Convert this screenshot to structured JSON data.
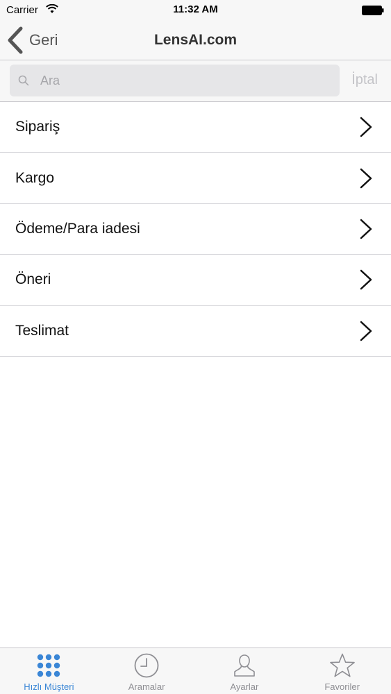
{
  "status_bar": {
    "carrier": "Carrier",
    "time": "11:32 AM"
  },
  "nav": {
    "back_label": "Geri",
    "title": "LensAI.com"
  },
  "search": {
    "placeholder": "Ara",
    "value": "",
    "cancel_label": "İptal"
  },
  "menu": {
    "items": [
      {
        "label": "Sipariş"
      },
      {
        "label": "Kargo"
      },
      {
        "label": "Ödeme/Para iadesi"
      },
      {
        "label": "Öneri"
      },
      {
        "label": "Teslimat"
      }
    ]
  },
  "tabs": {
    "items": [
      {
        "label": "Hızlı Müşteri",
        "icon": "grid-dots-icon",
        "active": true
      },
      {
        "label": "Aramalar",
        "icon": "clock-icon",
        "active": false
      },
      {
        "label": "Ayarlar",
        "icon": "person-icon",
        "active": false
      },
      {
        "label": "Favoriler",
        "icon": "star-icon",
        "active": false
      }
    ]
  },
  "colors": {
    "accent": "#3a86d6",
    "inactive": "#8e8e93",
    "bar_background": "#f7f7f7"
  }
}
